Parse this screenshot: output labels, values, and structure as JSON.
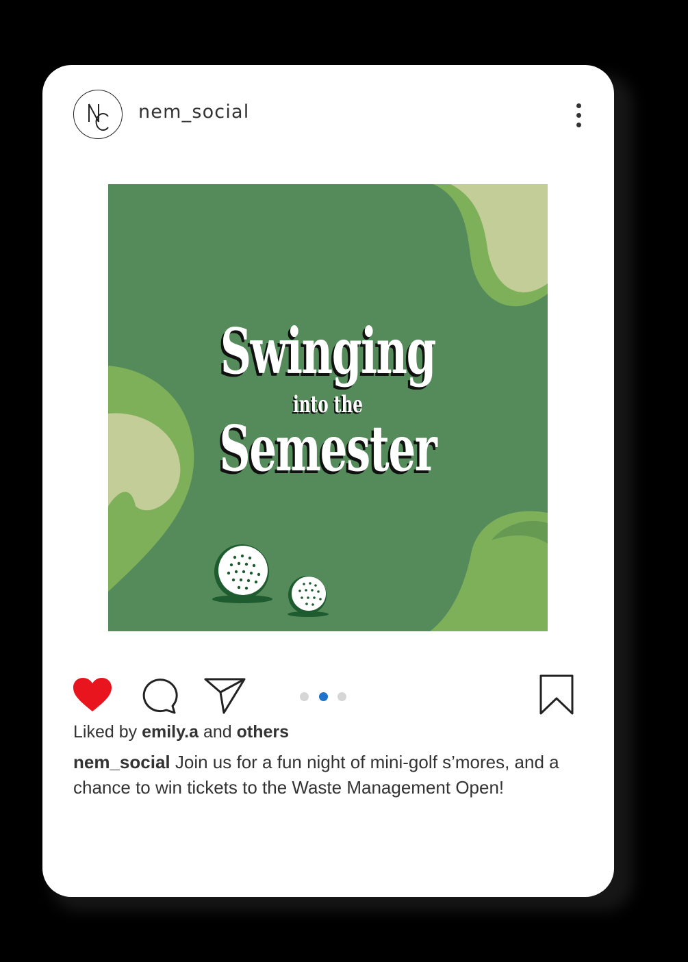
{
  "post": {
    "username": "nem_social",
    "avatar_monogram": "NC",
    "image": {
      "headline_line1": "Swinging",
      "headline_line2": "into the",
      "headline_line3": "Semester",
      "colors": {
        "background": "#558b5b",
        "blob_light": "#7eb05a",
        "blob_pale": "#c3cd97",
        "ball": "#ffffff",
        "ball_shadow": "#1e5b2f"
      }
    },
    "actions": {
      "like_icon": "heart-filled-icon",
      "comment_icon": "comment-bubble-icon",
      "share_icon": "paper-plane-icon",
      "save_icon": "bookmark-icon",
      "like_color": "#e8151f",
      "carousel_total": 3,
      "carousel_active": 2
    },
    "likes": {
      "prefix": "Liked by",
      "user": "emily.a",
      "joiner": "and",
      "suffix": "others"
    },
    "caption": {
      "username": "nem_social",
      "text": "Join us for a fun night of mini-golf s’mores, and a chance to win tickets to the Waste Management Open!"
    }
  }
}
